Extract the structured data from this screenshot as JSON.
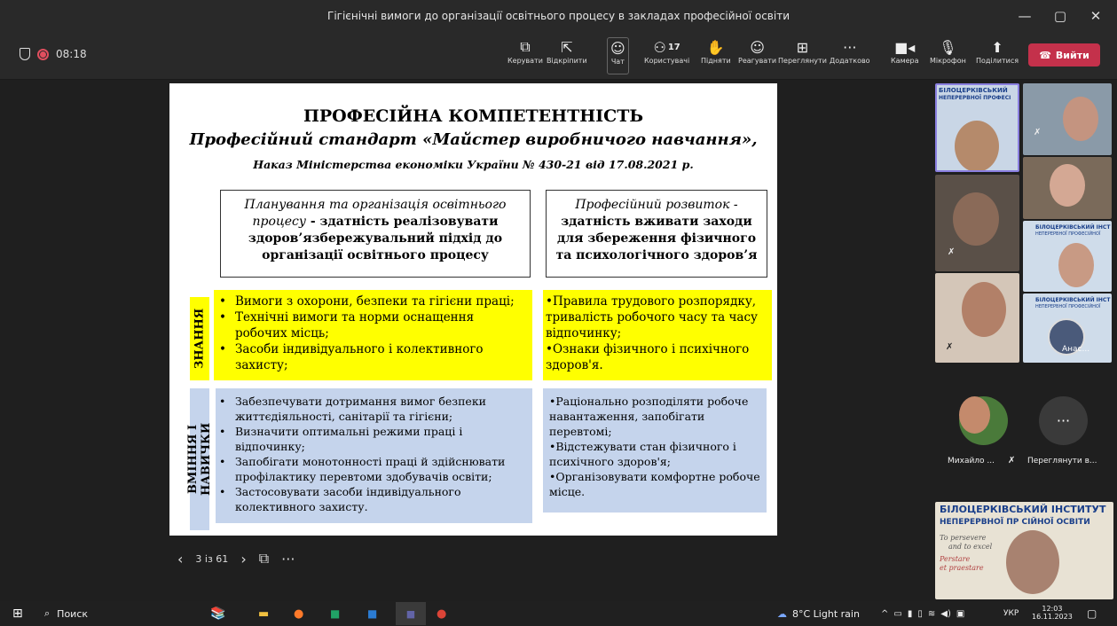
{
  "window": {
    "title": "Гігієнічні вимоги до організації освітнього процесу в закладах професійної освіти"
  },
  "toolbar": {
    "timer": "08:18",
    "manage": "Керувати",
    "popout": "Відкріпити",
    "chat": "Чат",
    "people": "Користувачі",
    "people_count": "17",
    "raise": "Підняти",
    "react": "Реагувати",
    "view": "Переглянути",
    "more": "Додатково",
    "camera": "Камера",
    "mic": "Мікрофон",
    "share": "Поділитися",
    "leave": "Вийти"
  },
  "slide": {
    "title": "ПРОФЕСІЙНА КОМПЕТЕНТНІСТЬ",
    "subtitle": "Професійний стандарт «Майстер виробничого навчання»,",
    "order": "Наказ Міністерства економіки України № 430-21 від 17.08.2021 р.",
    "left_head_italic": "Планування та організація освітнього процесу",
    "left_head_bold": " - здатність реалізовувати здоров’язбережувальний підхід до організації освітнього процесу",
    "right_head_italic": "Професійний розвиток -",
    "right_head_bold": "здатність вживати заходи для збереження фізичного та психологічного здоров’я",
    "label_knowledge": "ЗНАННЯ",
    "label_skills": "ВМІННЯ І НАВИЧКИ",
    "knowledge_left": [
      "Вимоги з охорони, безпеки та гігієни праці;",
      "Технічні вимоги та норми оснащення робочих місць;",
      "Засоби індивідуального і колективного захисту;"
    ],
    "knowledge_right": [
      "•Правила трудового розпорядку, тривалість робочого часу та часу відпочинку;",
      "•Ознаки фізичного і психічного здоров'я."
    ],
    "skills_left": [
      "Забезпечувати дотримання вимог безпеки життєдіяльності, санітарії та гігієни;",
      "Визначити оптимальні режими праці і відпочинку;",
      "Запобігати монотонності праці й здійснювати профілактику перевтоми здобувачів освіти;",
      "Застосовувати засоби індивідуального колективного захисту."
    ],
    "skills_right": [
      "•Раціонально розподіляти робоче навантаження, запобігати перевтомі;",
      "•Відстежувати стан фізичного і психічного здоров'я;",
      "•Організовувати комфортне робоче місце."
    ]
  },
  "slidenav": {
    "page": "3 із 61"
  },
  "participants": {
    "banner1": "БІЛОЦЕРКІВСЬКИЙ",
    "banner1b": "НЕПЕРЕРВНОЇ ПРОФЕСІ",
    "banner2": "БІЛОЦЕРКІВСЬКИЙ ІНСТ",
    "banner2b": "НЕПЕРЕРВНОЇ ПРОФЕСІЙНОЇ",
    "banner3": "БІЛОЦЕРКІВСЬКИЙ ІНСТ",
    "banner3b": "НЕПЕРЕРВНОЇ ПРОФЕСІЙНОЇ",
    "anas": "Анас...",
    "mykhailo": "Михайло ...",
    "view_more": "Переглянути в...",
    "big_banner1": "БІЛОЦЕРКІВСЬКИЙ ІНСТИТУТ",
    "big_banner2": "НЕПЕРЕРВНОЇ ПР   СІЙНОЇ ОСВІТИ",
    "big_motto1": "To persevere",
    "big_motto2": "and to excel",
    "big_motto3": "Perstare",
    "big_motto4": "et praestare"
  },
  "taskbar": {
    "search": "Поиск",
    "weather": "8°C Light rain",
    "lang": "УКР",
    "time": "12:03",
    "date": "16.11.2023"
  },
  "colors": {
    "accent": "#c4314b",
    "yellow": "#ffff00",
    "blue": "#c5d4ec",
    "bg": "#1f1f1f"
  }
}
